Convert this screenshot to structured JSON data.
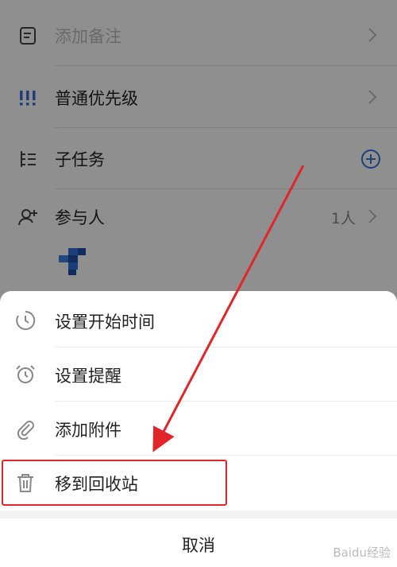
{
  "detail": {
    "rows": [
      {
        "label": "添加备注",
        "icon": "note-icon"
      },
      {
        "label": "普通优先级",
        "icon": "priority-icon"
      },
      {
        "label": "子任务",
        "icon": "subtask-icon"
      },
      {
        "label": "参与人",
        "icon": "participant-icon",
        "extra": "1人"
      }
    ]
  },
  "sheet": {
    "items": [
      {
        "label": "设置开始时间",
        "icon": "clock-icon"
      },
      {
        "label": "设置提醒",
        "icon": "alarm-icon"
      },
      {
        "label": "添加附件",
        "icon": "paperclip-icon"
      },
      {
        "label": "移到回收站",
        "icon": "trash-icon"
      }
    ],
    "cancel_label": "取消"
  },
  "watermark": "Baidu经验",
  "colors": {
    "accent": "#3b6fd8",
    "highlight": "#e0262b",
    "overlay": "rgba(0,0,0,0.44)"
  }
}
